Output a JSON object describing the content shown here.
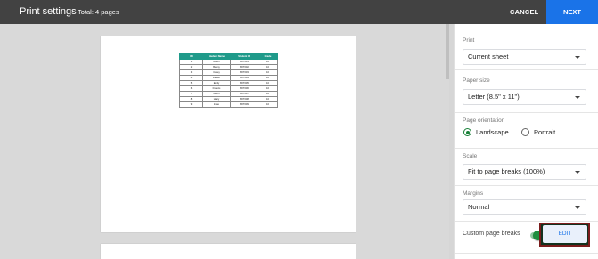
{
  "header": {
    "title": "Print settings",
    "subtitle": "Total: 4 pages",
    "cancel_label": "CANCEL",
    "next_label": "NEXT"
  },
  "sheet": {
    "columns": [
      "ID",
      "Student Name",
      "Student ID",
      "Grade"
    ],
    "rows": [
      [
        "1",
        "Aaron",
        "BDT001",
        "10"
      ],
      [
        "2",
        "Benny",
        "BDT002",
        "10"
      ],
      [
        "3",
        "Casey",
        "BDT003",
        "10"
      ],
      [
        "4",
        "Darren",
        "BDT004",
        "10"
      ],
      [
        "5",
        "Emily",
        "BDT005",
        "10"
      ],
      [
        "6",
        "Francis",
        "BDT006",
        "10"
      ],
      [
        "7",
        "Glenn",
        "BDT007",
        "10"
      ],
      [
        "8",
        "Harry",
        "BDT008",
        "10"
      ],
      [
        "9",
        "Irene",
        "BDT009",
        "10"
      ]
    ]
  },
  "settings": {
    "print": {
      "label": "Print",
      "value": "Current sheet"
    },
    "paper_size": {
      "label": "Paper size",
      "value": "Letter (8.5\" x 11\")"
    },
    "orientation": {
      "label": "Page orientation",
      "options": [
        "Landscape",
        "Portrait"
      ],
      "selected": "Landscape"
    },
    "scale": {
      "label": "Scale",
      "value": "Fit to page breaks (100%)"
    },
    "margins": {
      "label": "Margins",
      "value": "Normal"
    },
    "page_breaks": {
      "label": "Custom page breaks",
      "enabled": true,
      "edit_label": "EDIT"
    }
  },
  "colors": {
    "accent": "#1a73e8",
    "toggle": "#1e8e3e",
    "table_header": "#1f9a8a",
    "topbar": "#424242"
  }
}
